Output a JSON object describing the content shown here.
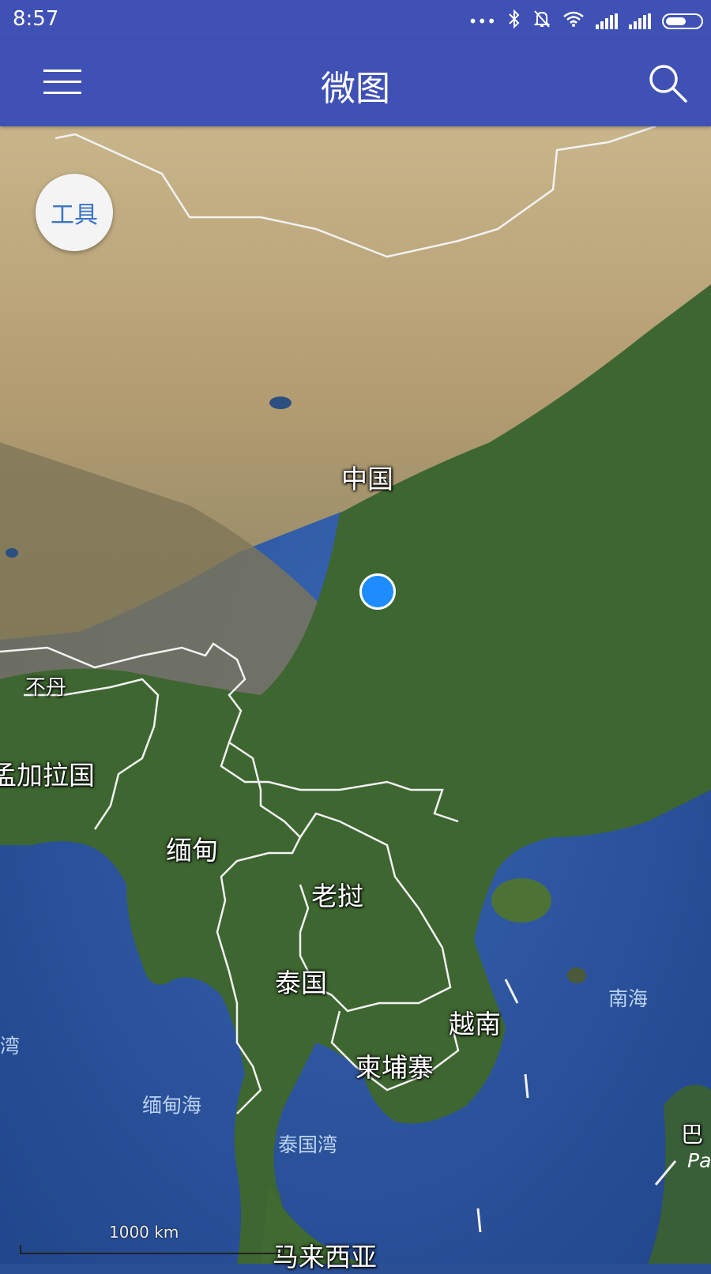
{
  "status_bar": {
    "time": "8:57",
    "icons": [
      "dots-icon",
      "bluetooth-icon",
      "mute-icon",
      "wifi-icon",
      "signal-icon",
      "signal-icon",
      "battery-icon"
    ],
    "battery_level": 0.6
  },
  "app_bar": {
    "title": "微图",
    "menu_icon": "hamburger-menu-icon",
    "search_icon": "search-icon"
  },
  "tools_button": {
    "label": "工具"
  },
  "map": {
    "countries": [
      {
        "key": "china",
        "label": "中国"
      },
      {
        "key": "bhutan",
        "label": "不丹"
      },
      {
        "key": "bangladesh",
        "label": "孟加拉国"
      },
      {
        "key": "myanmar",
        "label": "缅甸"
      },
      {
        "key": "laos",
        "label": "老挝"
      },
      {
        "key": "thailand",
        "label": "泰国"
      },
      {
        "key": "vietnam",
        "label": "越南"
      },
      {
        "key": "cambodia",
        "label": "柬埔寨"
      },
      {
        "key": "malaysia",
        "label": "马来西亚"
      },
      {
        "key": "papua",
        "label": "巴"
      }
    ],
    "waters": [
      {
        "key": "south_china_sea",
        "label": "南海"
      },
      {
        "key": "andaman_sea",
        "label": "缅甸海"
      },
      {
        "key": "gulf_of_thailand",
        "label": "泰国湾"
      },
      {
        "key": "bay",
        "label": "湾"
      },
      {
        "key": "papua_en",
        "label": "Pa"
      }
    ],
    "scale_label": "1000 km",
    "colors": {
      "sea": "#2c55a0",
      "land_green": "#3f6a31",
      "desert": "#b9a57a",
      "border": "#f2f2f2",
      "location": "#1e8cff",
      "app_bar": "#3f51b5"
    }
  }
}
